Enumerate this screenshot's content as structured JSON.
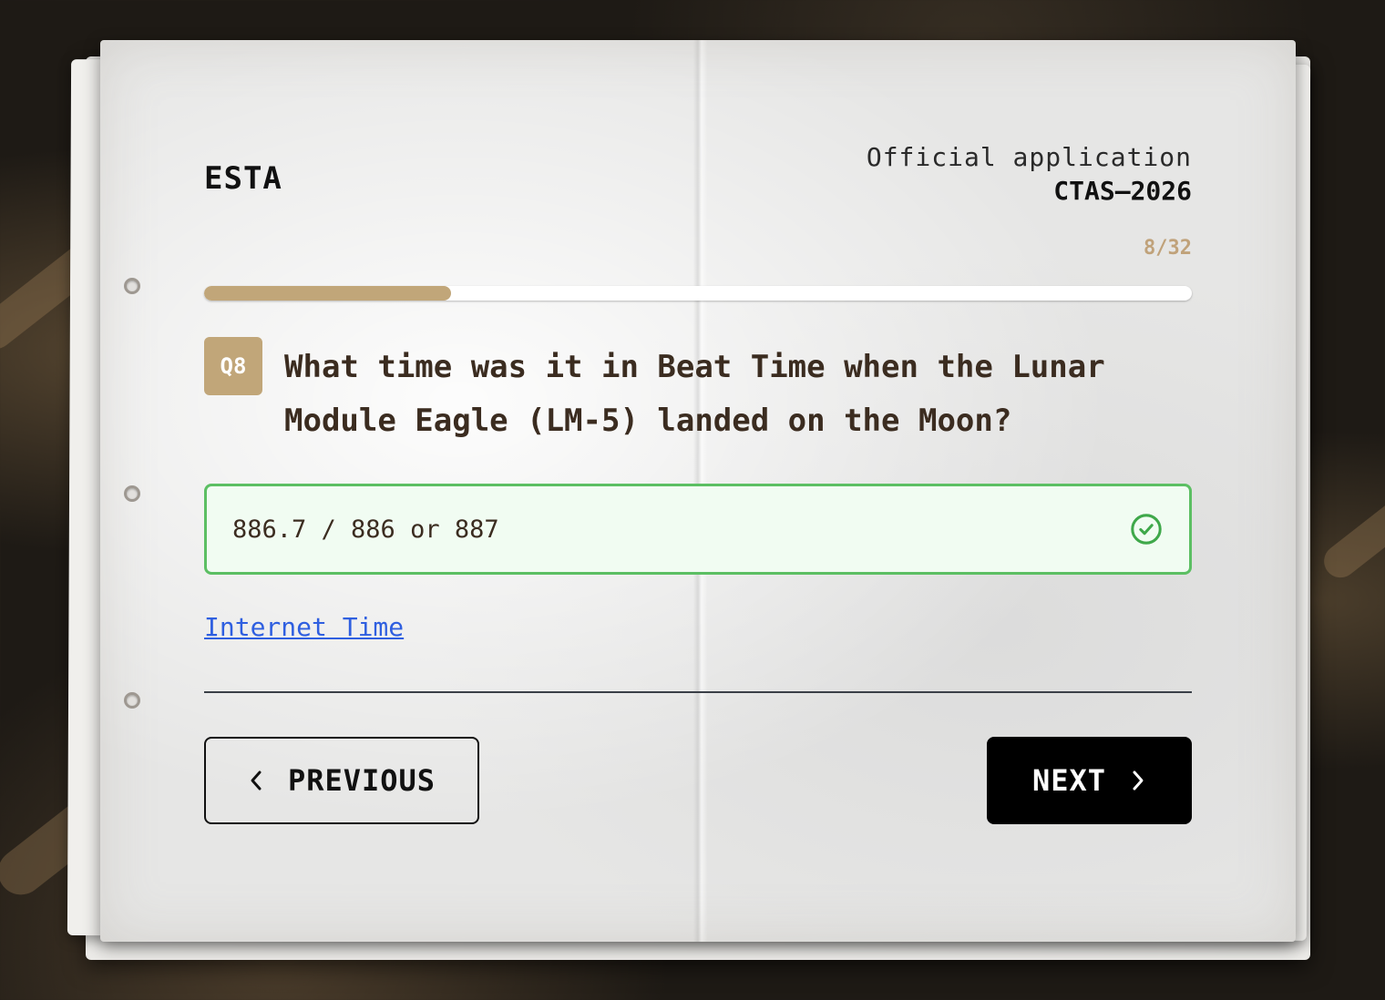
{
  "header": {
    "brand": "ESTA",
    "subtitle": "Official application",
    "code": "CTAS–2026"
  },
  "progress": {
    "label": "8/32",
    "current": 8,
    "total": 32,
    "fraction": 0.25
  },
  "question": {
    "badge": "Q8",
    "text": "What time was it in Beat Time when the Lunar Module Eagle (LM-5) landed on the Moon?"
  },
  "answer": {
    "value": "886.7 / 886 or 887",
    "status": "correct",
    "status_icon": "check-circle-icon"
  },
  "hint": {
    "label": "Internet Time"
  },
  "navigation": {
    "previous_label": "PREVIOUS",
    "previous_icon": "chevron-left-icon",
    "next_label": "NEXT",
    "next_icon": "chevron-right-icon"
  },
  "colors": {
    "accent": "#c1a679",
    "success": "#5cbf63",
    "link": "#2f5fe0",
    "question_text": "#3b2c20"
  }
}
